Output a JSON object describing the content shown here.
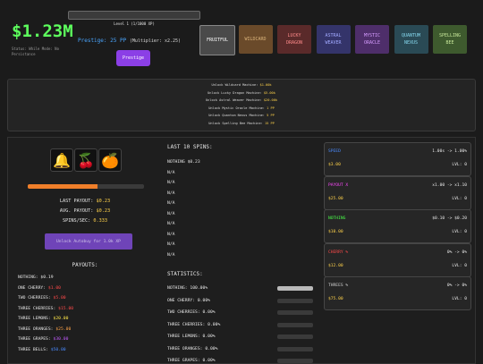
{
  "header": {
    "money": "$1.23M",
    "status": "Status: While Mode: No Persistance",
    "level_text": "Level 1 (1/1000 XP)",
    "prestige_label": "Prestige: 25 PP",
    "prestige_multiplier": "(Multiplier: x2.25)",
    "prestige_button": "Prestige"
  },
  "machines": [
    {
      "label": "FRUITFUL",
      "color": "#4a4a4a",
      "text": "#ffffff"
    },
    {
      "label": "WILDCARD",
      "color": "#6a4a2a",
      "text": "#d9b27a"
    },
    {
      "label": "LUCKY\nDRAGON",
      "color": "#5a2a2a",
      "text": "#ff8a8a"
    },
    {
      "label": "ASTRAL\nWEAVER",
      "color": "#34346a",
      "text": "#a0a8ff"
    },
    {
      "label": "MYSTIC\nORACLE",
      "color": "#4e2e6a",
      "text": "#d69cff"
    },
    {
      "label": "QUANTUM\nNEXUS",
      "color": "#2a4a55",
      "text": "#86d8ee"
    },
    {
      "label": "SPELLING\nBEE",
      "color": "#3e5a2e",
      "text": "#c8e89a"
    }
  ],
  "unlocks": [
    {
      "text": "Unlock Wildcard Machine: ",
      "cost": "$1.00k"
    },
    {
      "text": "Unlock Lucky Dragon Machine: ",
      "cost": "$5.00k"
    },
    {
      "text": "Unlock Astral Weaver Machine: ",
      "cost": "$20.00k"
    },
    {
      "text": "Unlock Mystic Oracle Machine: ",
      "cost": "1 PP"
    },
    {
      "text": "Unlock Quantum Nexus Machine: ",
      "cost": "5 PP"
    },
    {
      "text": "Unlock Spelling Bee Machine: ",
      "cost": "15 PP"
    }
  ],
  "reels": [
    "🔔",
    "🍒",
    "🍊"
  ],
  "spin_progress": 0.6,
  "stats": {
    "last_label": "LAST PAYOUT: ",
    "last_value": "$0.23",
    "avg_label": "AVG. PAYOUT: ",
    "avg_value": "$0.23",
    "sps_label": "SPINS/SEC: ",
    "sps_value": "0.333"
  },
  "autobuy_button": "Unlock Autobuy for 1.0k XP",
  "payouts": {
    "title": "PAYOUTS:",
    "rows": [
      {
        "label": "NOTHING: ",
        "value": "$0.19",
        "color": "#e6e6e6"
      },
      {
        "label": "ONE CHERRY: ",
        "value": "$1.00",
        "color": "#ff4a4a"
      },
      {
        "label": "TWO CHERRIES: ",
        "value": "$5.00",
        "color": "#ff4a4a"
      },
      {
        "label": "THREE CHERRIES: ",
        "value": "$15.00",
        "color": "#ff4a4a"
      },
      {
        "label": "THREE LEMONS: ",
        "value": "$20.00",
        "color": "#ffe84a"
      },
      {
        "label": "THREE ORANGES: ",
        "value": "$25.00",
        "color": "#ffa54a"
      },
      {
        "label": "THREE GRAPES: ",
        "value": "$30.00",
        "color": "#c25aff"
      },
      {
        "label": "THREE BELLS: ",
        "value": "$50.00",
        "color": "#4a8bff"
      }
    ]
  },
  "last_spins": {
    "title": "LAST 10 SPINS:",
    "rows": [
      "NOTHING $0.23",
      "N/A",
      "N/A",
      "N/A",
      "N/A",
      "N/A",
      "N/A",
      "N/A",
      "N/A",
      "N/A"
    ]
  },
  "statistics": {
    "title": "STATISTICS:",
    "rows": [
      {
        "label": "NOTHING: 100.00%",
        "fill": 1.0
      },
      {
        "label": "ONE CHERRY: 0.00%",
        "fill": 0
      },
      {
        "label": "TWO CHERRIES: 0.00%",
        "fill": 0
      },
      {
        "label": "THREE CHERRIES: 0.00%",
        "fill": 0
      },
      {
        "label": "THREE LEMONS: 0.00%",
        "fill": 0
      },
      {
        "label": "THREE ORANGES: 0.00%",
        "fill": 0
      },
      {
        "label": "THREE GRAPES: 0.00%",
        "fill": 0
      }
    ]
  },
  "upgrades": [
    {
      "name": "SPEED",
      "color": "#4a8bff",
      "mult": "1.00s -> 1.00%",
      "price": "$3.00",
      "level": "LVL: 0"
    },
    {
      "name": "PAYOUT X",
      "color": "#ff4aff",
      "mult": "x1.00 -> x1.10",
      "price": "$25.00",
      "level": "LVL: 0"
    },
    {
      "name": "NOTHING",
      "color": "#4aff4a",
      "mult": "$0.10 -> $0.20",
      "price": "$10.00",
      "level": "LVL: 0"
    },
    {
      "name": "CHERRY %",
      "color": "#ff4a4a",
      "mult": "0% -> 0%",
      "price": "$12.00",
      "level": "LVL: 0"
    },
    {
      "name": "THREES %",
      "color": "#cfcfcf",
      "mult": "0% -> 0%",
      "price": "$75.00",
      "level": "LVL: 0"
    }
  ]
}
